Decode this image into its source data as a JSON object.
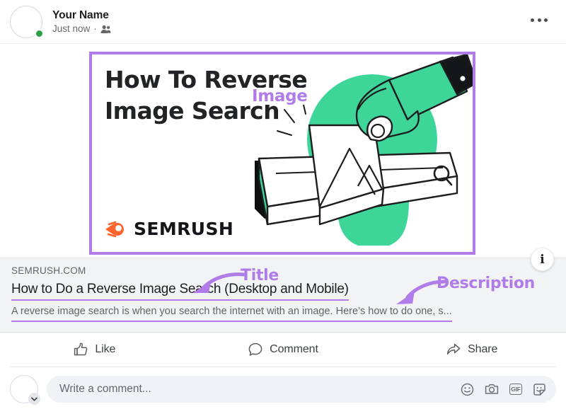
{
  "post": {
    "author": "Your Name",
    "timestamp": "Just now",
    "meta_separator": "·",
    "audience_icon": "friends-icon",
    "more_icon": "more-horizontal-icon",
    "online_status": "online",
    "avatar_icon": "avatar-placeholder"
  },
  "media": {
    "headline": "How To Reverse\nImage Search",
    "brand": "SEMRUSH",
    "brand_icon": "semrush-comet-logo",
    "illustration_name": "hand-pulling-photo-from-search-bar",
    "info_button_label": "i",
    "border_color": "#b07ce8",
    "brand_green": "#3ed598"
  },
  "annotations": {
    "image_label": "Image",
    "title_label": "Title",
    "description_label": "Description",
    "color": "#b07ce8"
  },
  "link_preview": {
    "domain": "SEMRUSH.COM",
    "title": "How to Do a Reverse Image Search (Desktop and Mobile)",
    "description": "A reverse image search is when you search the internet with an image. Here’s how to do one, s...",
    "background": "#f2f3f5"
  },
  "actions": [
    {
      "label": "Like",
      "icon": "thumbs-up-icon"
    },
    {
      "label": "Comment",
      "icon": "comment-bubble-icon"
    },
    {
      "label": "Share",
      "icon": "share-arrow-icon"
    }
  ],
  "composer": {
    "placeholder": "Write a comment...",
    "avatar_icon": "avatar-placeholder",
    "chevron_icon": "chevron-down-icon",
    "icons": [
      {
        "name": "emoji-icon"
      },
      {
        "name": "camera-icon"
      },
      {
        "name": "gif-icon",
        "label": "GIF"
      },
      {
        "name": "sticker-icon"
      }
    ]
  }
}
